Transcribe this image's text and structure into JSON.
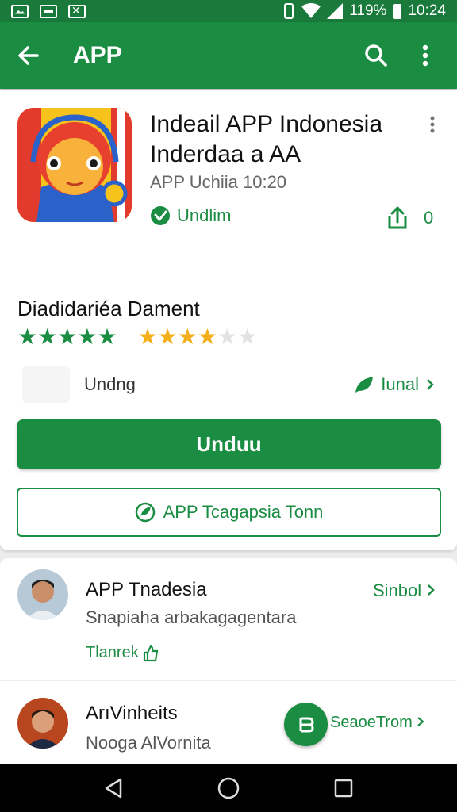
{
  "status_bar": {
    "battery": "119%",
    "time": "10:24",
    "notification_icons": [
      "image-icon",
      "chat-icon",
      "x-icon"
    ]
  },
  "app_bar": {
    "title": "APP",
    "icons": [
      "back-arrow-icon",
      "search-icon",
      "more-vert-icon"
    ]
  },
  "app_info": {
    "name": "Indeail APP Indonesia Inderdaa a AA",
    "version": "APP Uchiia 10:20",
    "verified_label": "Undlim",
    "share_count": "0"
  },
  "ratings": {
    "title": "Diadidariéa Dament",
    "green_stars": 4.5,
    "gold_stars": 4,
    "max_stars": 5
  },
  "detail_row": {
    "label": "Undng",
    "link_label": "Iunal"
  },
  "buttons": {
    "primary_label": "Unduu",
    "secondary_label": "APP Tcagapsia Tonn"
  },
  "reviews": [
    {
      "name": "APP Tnadesia",
      "subtitle": "Snapiaha arbakagagentara",
      "see_label": "Sinbol",
      "helpful_label": "Tlanrek"
    },
    {
      "name": "ArıVinheits",
      "subtitle": "Nooga AlVornita"
    }
  ],
  "fab": {
    "label": "SeaoeTrom"
  },
  "colors": {
    "brand_green": "#1a8d43",
    "status_green": "#1a7a3c",
    "star_gold": "#f3b01b"
  }
}
